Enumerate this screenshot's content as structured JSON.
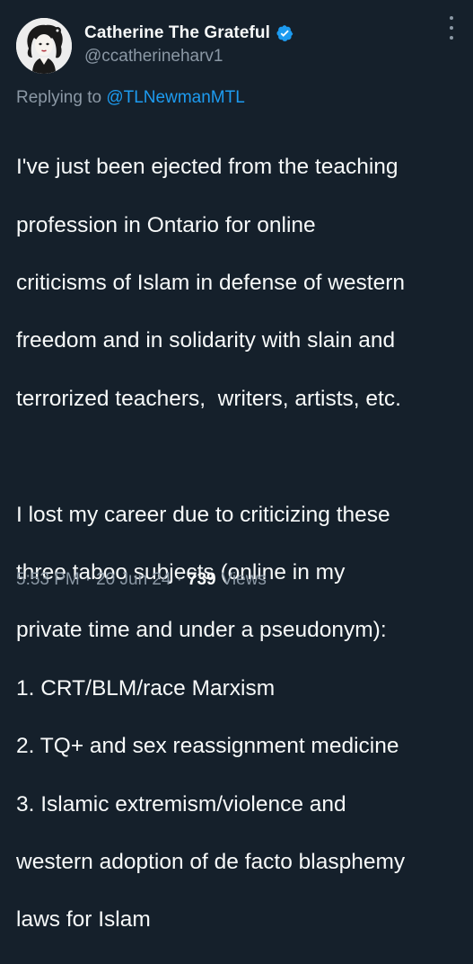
{
  "author": {
    "display_name": "Catherine The Grateful",
    "handle": "@ccatherineharv1",
    "verified": true
  },
  "reply": {
    "prefix": "Replying to",
    "to_handle": "@TLNewmanMTL"
  },
  "tweet": {
    "lines_para1": [
      "I've just been ejected from the teaching",
      "profession in Ontario for online",
      "criticisms of Islam in defense of western",
      "freedom and in solidarity with slain and",
      "terrorized teachers,  writers, artists, etc."
    ],
    "lines_para2": [
      "I lost my career due to criticizing these",
      "three taboo subjects (online in my",
      "private time and under a pseudonym):",
      "1. CRT/BLM/race Marxism",
      "2. TQ+ and sex reassignment medicine",
      "3. Islamic extremism/violence and",
      "western adoption of de facto blasphemy",
      "laws for Islam"
    ]
  },
  "meta": {
    "time": "5:53 PM",
    "date": "20 Jun 24",
    "separator": "·",
    "views_count": "739",
    "views_label": "Views"
  },
  "colors": {
    "background": "#15202b",
    "text": "#f7f9f9",
    "muted": "#8b98a5",
    "link": "#1d9bf0",
    "verified": "#1d9bf0"
  },
  "icons": {
    "verified": "verified-badge-icon",
    "more": "more-options-icon"
  }
}
